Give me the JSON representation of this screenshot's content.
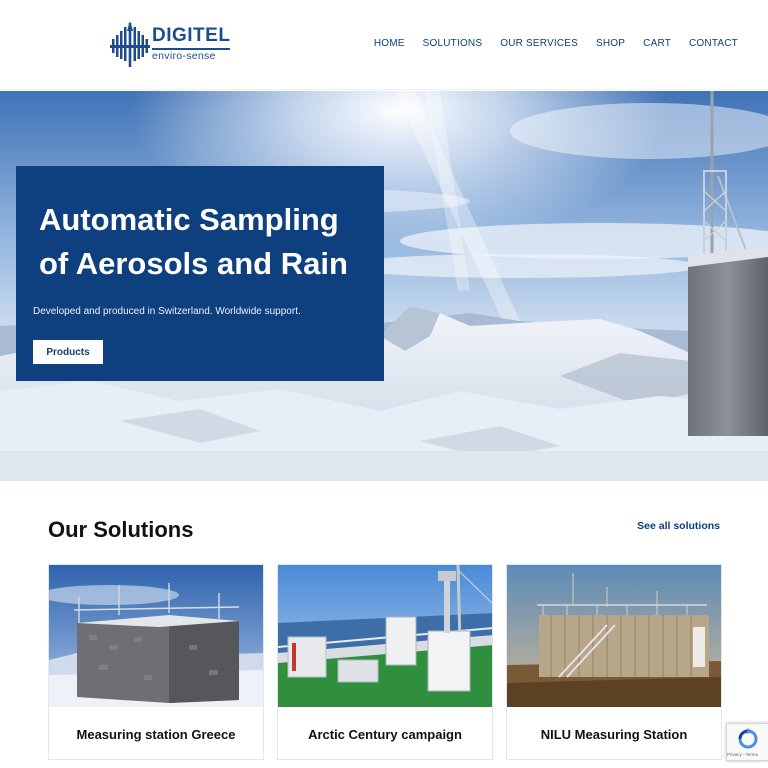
{
  "brand": {
    "name": "DIGITEL",
    "tagline": "enviro-sense",
    "color": "#1d4c8c"
  },
  "nav": {
    "items": [
      "HOME",
      "SOLUTIONS",
      "OUR SERVICES",
      "SHOP",
      "CART",
      "CONTACT"
    ]
  },
  "hero": {
    "title_line1": "Automatic Sampling",
    "title_line2": "of Aerosols and Rain",
    "subtitle": "Developed and produced in Switzerland. Worldwide support.",
    "button_label": "Products",
    "box_color": "#0e3f7e"
  },
  "solutions": {
    "heading": "Our Solutions",
    "see_all": "See all solutions",
    "cards": [
      {
        "title": "Measuring station Greece"
      },
      {
        "title": "Arctic Century campaign"
      },
      {
        "title": "NILU Measuring Station"
      }
    ]
  },
  "recaptcha": {
    "label": "Privacy - Terms"
  }
}
